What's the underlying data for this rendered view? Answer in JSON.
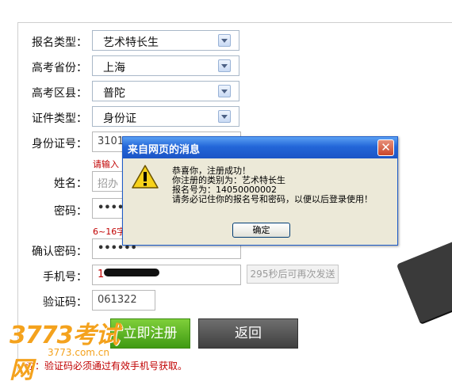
{
  "form": {
    "reg_type": {
      "label": "报名类型：",
      "value": "艺术特长生"
    },
    "province": {
      "label": "高考省份：",
      "value": "上海"
    },
    "district": {
      "label": "高考区县：",
      "value": "普陀"
    },
    "id_type": {
      "label": "证件类型：",
      "value": "身份证"
    },
    "id_number": {
      "label": "身份证号：",
      "value": "3101"
    },
    "id_hint": "请输入",
    "name": {
      "label": "姓名：",
      "placeholder": "招办"
    },
    "password": {
      "label": "密码：",
      "value": "••••"
    },
    "password_hint": "6~16字",
    "confirm_password": {
      "label": "确认密码：",
      "value": "••••••"
    },
    "phone": {
      "label": "手机号：",
      "value": "1"
    },
    "resend_label": "295秒后可再次发送",
    "code": {
      "label": "验证码：",
      "value": "061322"
    },
    "submit_label": "立即注册",
    "back_label": "返回",
    "note": "注：验证码必须通过有效手机号获取。"
  },
  "watermark": {
    "main": "3773考试网",
    "sub": "3773.com.cn"
  },
  "dialog": {
    "title": "来自网页的消息",
    "close_glyph": "✕",
    "lines": [
      "恭喜你，注册成功！",
      "你注册的类别为：艺术特长生",
      "报名号为：14050000002",
      "请务必记住你的报名号和密码，以便以后登录使用！"
    ],
    "ok_label": "确定"
  },
  "icons": {
    "dropdown": "chevron-down-icon",
    "warning": "warning-icon",
    "close": "close-icon"
  },
  "colors": {
    "submit": "#4aa41a",
    "back": "#555555",
    "hint": "#c00000",
    "dialog_title": "#2366d8"
  }
}
